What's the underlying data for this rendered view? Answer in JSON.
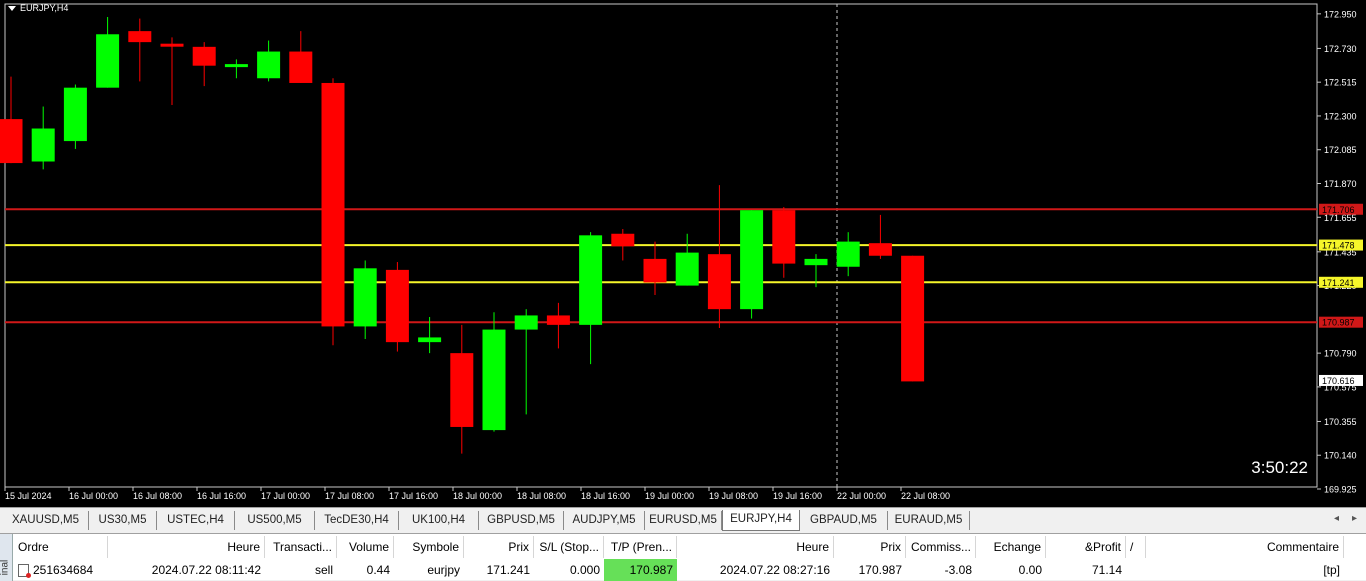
{
  "chart": {
    "symbol_label": "EURJPY,H4",
    "timer": "3:50:22",
    "ylim": [
      169.925,
      173.0
    ],
    "price_ticks": [
      "172.950",
      "172.730",
      "172.515",
      "172.300",
      "172.085",
      "171.870",
      "171.655",
      "171.435",
      "171.220",
      "170.790",
      "170.575",
      "170.355",
      "170.140",
      "169.925"
    ],
    "time_ticks": [
      "15 Jul 2024",
      "16 Jul 00:00",
      "16 Jul 08:00",
      "16 Jul 16:00",
      "17 Jul 00:00",
      "17 Jul 08:00",
      "17 Jul 16:00",
      "18 Jul 00:00",
      "18 Jul 08:00",
      "18 Jul 16:00",
      "19 Jul 00:00",
      "19 Jul 08:00",
      "19 Jul 16:00",
      "22 Jul 00:00",
      "22 Jul 08:00"
    ],
    "hlines": [
      {
        "price": 171.706,
        "label": "171.706",
        "color": "#d01818"
      },
      {
        "price": 171.478,
        "label": "171.478",
        "color": "#f5f52a"
      },
      {
        "price": 171.241,
        "label": "171.241",
        "color": "#f5f52a"
      },
      {
        "price": 170.987,
        "label": "170.987",
        "color": "#d01818"
      }
    ],
    "current_price_label": "170.616",
    "bull_color": "#00ff00",
    "bear_color": "#ff0000",
    "candles": [
      {
        "o": 172.28,
        "h": 172.55,
        "l": 172.0,
        "c": 172.0
      },
      {
        "o": 172.01,
        "h": 172.36,
        "l": 171.96,
        "c": 172.22
      },
      {
        "o": 172.14,
        "h": 172.5,
        "l": 172.09,
        "c": 172.48
      },
      {
        "o": 172.48,
        "h": 172.93,
        "l": 172.48,
        "c": 172.82
      },
      {
        "o": 172.84,
        "h": 172.92,
        "l": 172.52,
        "c": 172.77
      },
      {
        "o": 172.76,
        "h": 172.8,
        "l": 172.37,
        "c": 172.75
      },
      {
        "o": 172.74,
        "h": 172.77,
        "l": 172.49,
        "c": 172.62
      },
      {
        "o": 172.62,
        "h": 172.66,
        "l": 172.54,
        "c": 172.63
      },
      {
        "o": 172.54,
        "h": 172.78,
        "l": 172.52,
        "c": 172.71
      },
      {
        "o": 172.71,
        "h": 172.84,
        "l": 172.51,
        "c": 172.51
      },
      {
        "o": 172.51,
        "h": 172.54,
        "l": 170.84,
        "c": 170.96
      },
      {
        "o": 170.96,
        "h": 171.38,
        "l": 170.88,
        "c": 171.33
      },
      {
        "o": 171.32,
        "h": 171.37,
        "l": 170.8,
        "c": 170.86
      },
      {
        "o": 170.86,
        "h": 171.02,
        "l": 170.79,
        "c": 170.89
      },
      {
        "o": 170.79,
        "h": 170.97,
        "l": 170.15,
        "c": 170.32
      },
      {
        "o": 170.3,
        "h": 171.05,
        "l": 170.29,
        "c": 170.94
      },
      {
        "o": 170.94,
        "h": 171.07,
        "l": 170.4,
        "c": 171.03
      },
      {
        "o": 171.03,
        "h": 171.11,
        "l": 170.82,
        "c": 170.97
      },
      {
        "o": 170.97,
        "h": 171.56,
        "l": 170.72,
        "c": 171.54
      },
      {
        "o": 171.55,
        "h": 171.58,
        "l": 171.38,
        "c": 171.47
      },
      {
        "o": 171.39,
        "h": 171.5,
        "l": 171.16,
        "c": 171.24
      },
      {
        "o": 171.22,
        "h": 171.55,
        "l": 171.22,
        "c": 171.43
      },
      {
        "o": 171.42,
        "h": 171.86,
        "l": 170.95,
        "c": 171.07
      },
      {
        "o": 171.07,
        "h": 171.7,
        "l": 171.01,
        "c": 171.7
      },
      {
        "o": 171.7,
        "h": 171.72,
        "l": 171.27,
        "c": 171.36
      },
      {
        "o": 171.35,
        "h": 171.42,
        "l": 171.21,
        "c": 171.39
      },
      {
        "o": 171.34,
        "h": 171.56,
        "l": 171.28,
        "c": 171.5
      },
      {
        "o": 171.49,
        "h": 171.67,
        "l": 171.39,
        "c": 171.41
      },
      {
        "o": 171.41,
        "h": 171.41,
        "l": 170.61,
        "c": 170.61
      }
    ]
  },
  "tabs": [
    "XAUUSD,M5",
    "US30,M5",
    "USTEC,H4",
    "US500,M5",
    "TecDE30,H4",
    "UK100,H4",
    "GBPUSD,M5",
    "AUDJPY,M5",
    "EURUSD,M5",
    "EURJPY,H4",
    "GBPAUD,M5",
    "EURAUD,M5"
  ],
  "active_tab": "EURJPY,H4",
  "terminal": {
    "side_label": "inal",
    "headers": [
      "Ordre",
      "Heure",
      "Transacti...",
      "Volume",
      "Symbole",
      "Prix",
      "S/L (Stop...",
      "T/P (Pren...",
      "Heure",
      "Prix",
      "Commiss...",
      "Echange",
      "&Profit",
      "/",
      "Commentaire"
    ],
    "row": [
      "251634684",
      "2024.07.22 08:11:42",
      "sell",
      "0.44",
      "eurjpy",
      "171.241",
      "0.000",
      "170.987",
      "2024.07.22 08:27:16",
      "170.987",
      "-3.08",
      "0.00",
      "71.14",
      "",
      "[tp]"
    ],
    "tp_highlight": "#66e058"
  }
}
